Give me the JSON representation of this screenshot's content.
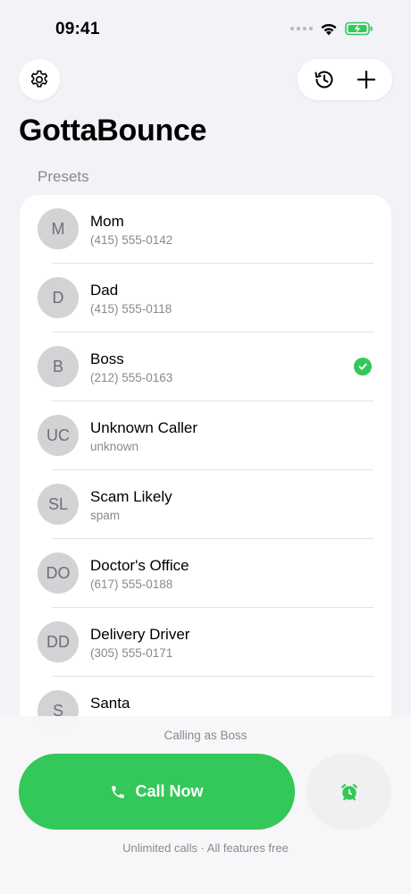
{
  "status_bar": {
    "time": "09:41"
  },
  "toolbar": {
    "settings_icon": "gear-icon",
    "history_icon": "history-icon",
    "add_icon": "plus-icon"
  },
  "app": {
    "title": "GottaBounce"
  },
  "presets": {
    "header": "Presets",
    "items": [
      {
        "initials": "M",
        "name": "Mom",
        "subtitle": "(415) 555-0142",
        "selected": false
      },
      {
        "initials": "D",
        "name": "Dad",
        "subtitle": "(415) 555-0118",
        "selected": false
      },
      {
        "initials": "B",
        "name": "Boss",
        "subtitle": "(212) 555-0163",
        "selected": true
      },
      {
        "initials": "UC",
        "name": "Unknown Caller",
        "subtitle": "unknown",
        "selected": false
      },
      {
        "initials": "SL",
        "name": "Scam Likely",
        "subtitle": "spam",
        "selected": false
      },
      {
        "initials": "DO",
        "name": "Doctor's Office",
        "subtitle": "(617) 555-0188",
        "selected": false
      },
      {
        "initials": "DD",
        "name": "Delivery Driver",
        "subtitle": "(305) 555-0171",
        "selected": false
      },
      {
        "initials": "S",
        "name": "Santa",
        "subtitle": "",
        "selected": false
      }
    ]
  },
  "bottom": {
    "calling_as": "Calling as Boss",
    "call_button_label": "Call Now",
    "footnote": "Unlimited calls · All features free"
  },
  "colors": {
    "accent": "#34C759",
    "background": "#F2F2F7",
    "avatar": "#D3D3D6"
  }
}
